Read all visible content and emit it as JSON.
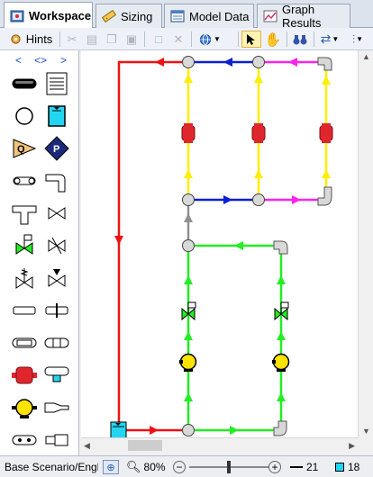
{
  "tabs": [
    {
      "label": "Workspace",
      "icon": "workspace-icon",
      "active": true
    },
    {
      "label": "Sizing",
      "icon": "sizing-icon",
      "active": false
    },
    {
      "label": "Model Data",
      "icon": "model-data-icon",
      "active": false
    },
    {
      "label": "Graph Results",
      "icon": "graph-results-icon",
      "active": false
    }
  ],
  "toolbar": {
    "hints_label": "Hints"
  },
  "palette": {
    "nav": [
      "<",
      "<>",
      ">"
    ]
  },
  "status": {
    "scenario": "Base Scenario/Engl...",
    "zoom": "80%",
    "pipe_count": "21",
    "junction_count": "18"
  },
  "colors": {
    "red": "#ee1111",
    "blue": "#0a1fd6",
    "magenta": "#ff22ee",
    "yellow": "#ffee00",
    "green": "#22ee22",
    "gray": "#909090",
    "tank": "#22d6f2"
  }
}
